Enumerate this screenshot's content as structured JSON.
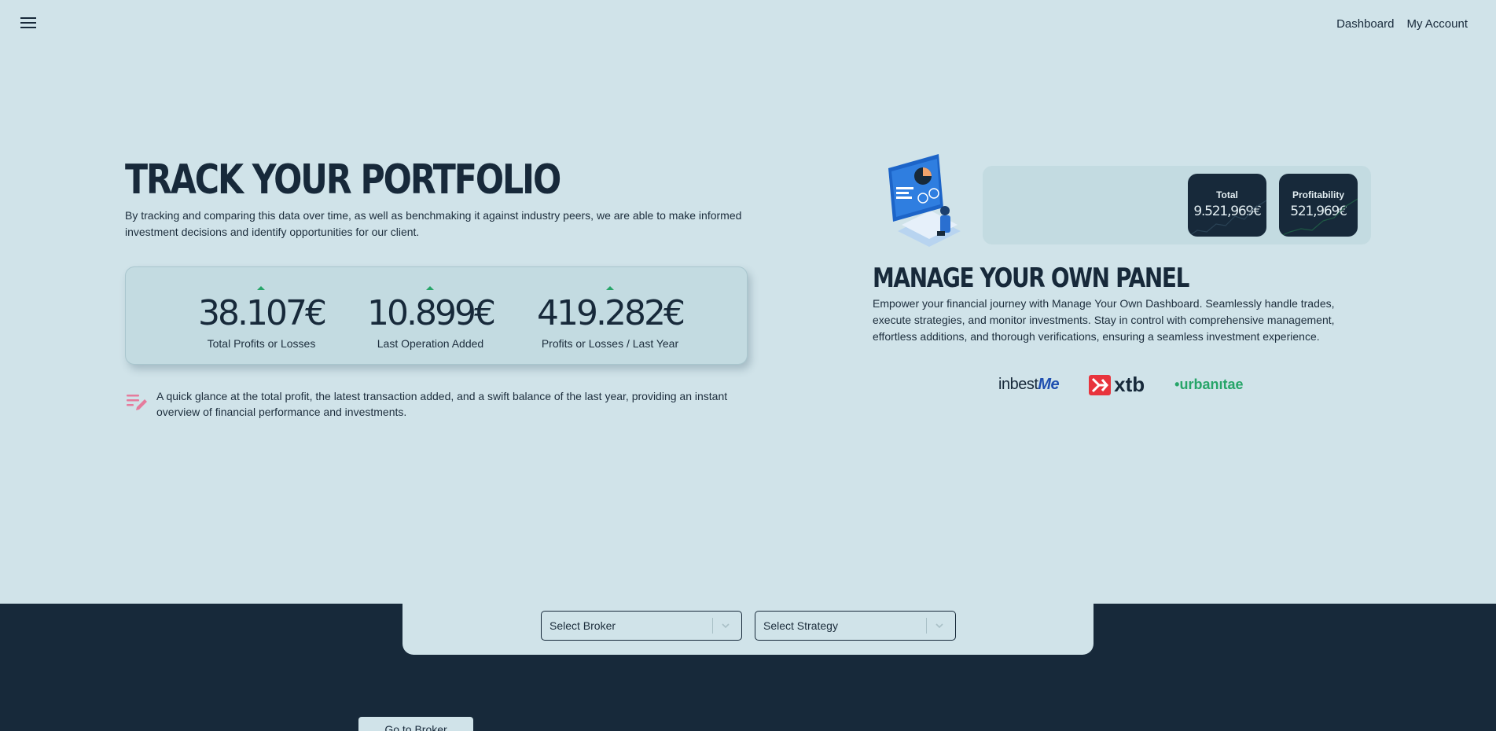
{
  "nav": {
    "menu_icon": "hamburger-icon",
    "links": [
      "Dashboard",
      "My Account"
    ]
  },
  "hero": {
    "title": "TRACK YOUR PORTFOLIO",
    "description": "By tracking and comparing this data over time, as well as benchmaking it against industry peers, we are able to make informed investment decisions and identify opportunities for our client."
  },
  "stats": [
    {
      "value": "38.107€",
      "label": "Total Profits or Losses",
      "trend": "up"
    },
    {
      "value": "10.899€",
      "label": "Last Operation Added",
      "trend": "up"
    },
    {
      "value": "419.282€",
      "label": "Profits or Losses / Last Year",
      "trend": "up"
    }
  ],
  "note": {
    "icon": "notes-edit-icon",
    "text": "A quick glance at the total profit, the latest transaction added, and a swift balance of the last year, providing an instant overview of financial performance and investments."
  },
  "panel": {
    "metrics": [
      {
        "title": "Total",
        "value": "9.521,969€"
      },
      {
        "title": "Profitability",
        "value": "521,969€"
      }
    ],
    "title": "MANAGE YOUR OWN PANEL",
    "description": "Empower your financial journey with Manage Your Own Dashboard. Seamlessly handle trades, execute strategies, and monitor investments. Stay in control with comprehensive management, effortless additions, and thorough verifications, ensuring a seamless investment experience."
  },
  "brokers": {
    "inbest_prefix": "inbest",
    "inbest_suffix": "Me",
    "xtb": "xtb",
    "urbanitae": "•urbanıtae"
  },
  "filters": {
    "broker_placeholder": "Select Broker",
    "strategy_placeholder": "Select Strategy"
  },
  "footer": {
    "button_label": "Go to Broker"
  },
  "colors": {
    "background": "#d0e3e9",
    "dark": "#17293a",
    "accent_green": "#27a569",
    "xtb_red": "#e8343d"
  }
}
